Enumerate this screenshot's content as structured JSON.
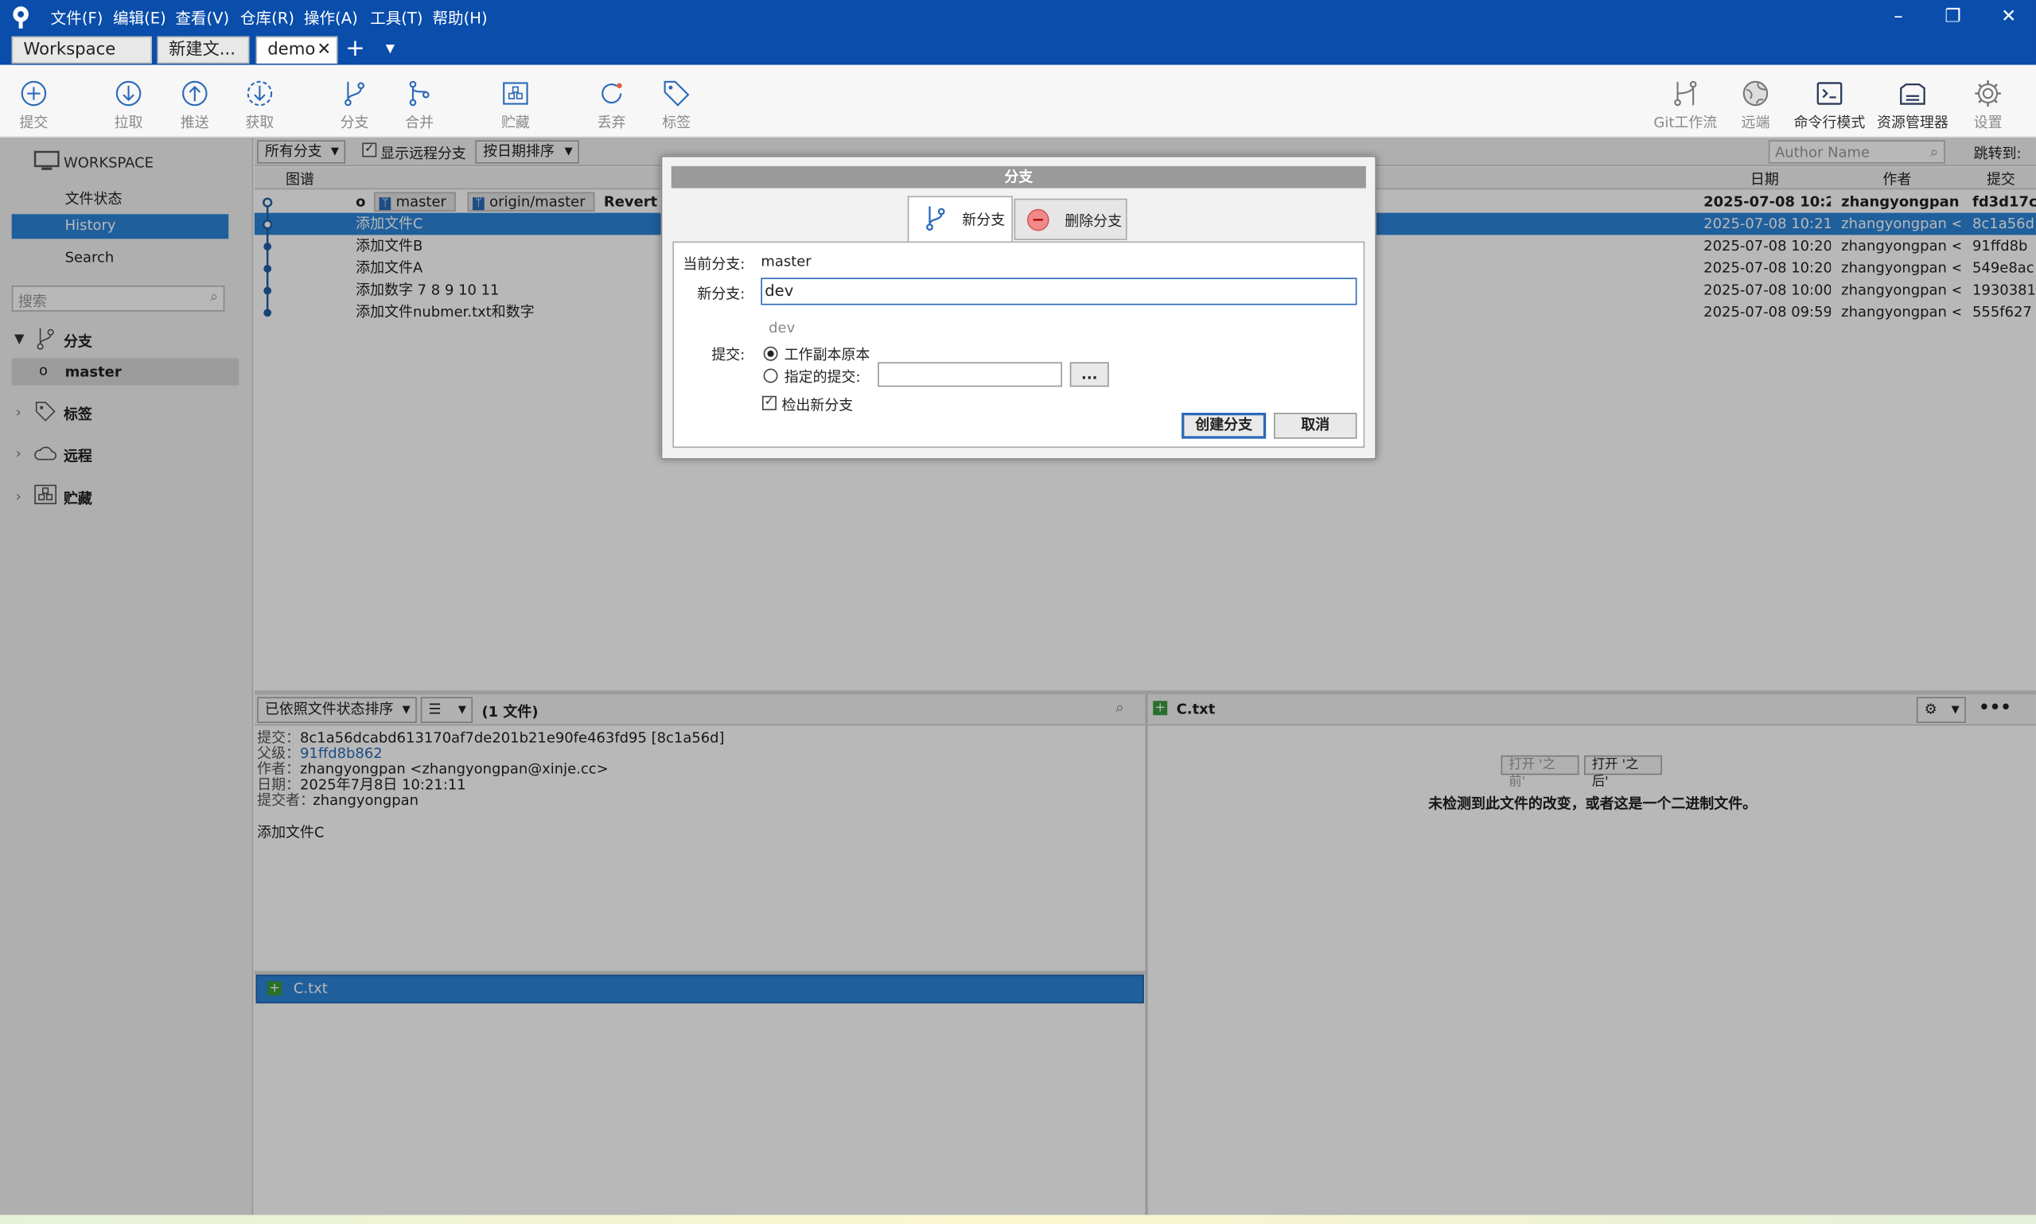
{
  "menu": [
    "文件(F)",
    "编辑(E)",
    "查看(V)",
    "仓库(R)",
    "操作(A)",
    "工具(T)",
    "帮助(H)"
  ],
  "tabs": [
    "Workspace",
    "新建文...",
    "demo"
  ],
  "toolbar_left": [
    {
      "label": "提交",
      "icon": "plus-circle-icon"
    },
    {
      "label": "拉取",
      "icon": "pull-icon"
    },
    {
      "label": "推送",
      "icon": "push-icon"
    },
    {
      "label": "获取",
      "icon": "fetch-icon"
    },
    {
      "label": "分支",
      "icon": "branch-icon"
    },
    {
      "label": "合并",
      "icon": "merge-icon"
    },
    {
      "label": "贮藏",
      "icon": "stash-icon"
    },
    {
      "label": "丢弃",
      "icon": "discard-icon"
    },
    {
      "label": "标签",
      "icon": "tag-icon"
    }
  ],
  "toolbar_right": [
    {
      "label": "Git工作流",
      "icon": "gitflow-icon"
    },
    {
      "label": "远端",
      "icon": "remote-globe-icon"
    },
    {
      "label": "命令行模式",
      "icon": "terminal-icon"
    },
    {
      "label": "资源管理器",
      "icon": "explorer-icon"
    },
    {
      "label": "设置",
      "icon": "gear-icon"
    }
  ],
  "sidebar": {
    "workspace": "WORKSPACE",
    "items": [
      "文件状态",
      "History",
      "Search"
    ],
    "search_placeholder": "搜索",
    "branches_header": "分支",
    "branch": "master",
    "tags": "标签",
    "remotes": "远程",
    "stashes": "贮藏"
  },
  "filters": {
    "branches": "所有分支",
    "show_remote": "显示远程分支",
    "sort": "按日期排序",
    "author_placeholder": "Author Name",
    "jump": "跳转到:"
  },
  "columns": {
    "graph": "图谱",
    "date": "日期",
    "author": "作者",
    "commit": "提交"
  },
  "commits": [
    {
      "labels": [
        "master",
        "origin/master"
      ],
      "message": "Revert \"",
      "date": "2025-07-08 10:2!",
      "author": "zhangyongpan ‹",
      "hash": "fd3d17c"
    },
    {
      "message": "添加文件C",
      "date": "2025-07-08 10:21",
      "author": "zhangyongpan <",
      "hash": "8c1a56d"
    },
    {
      "message": "添加文件B",
      "date": "2025-07-08 10:20",
      "author": "zhangyongpan <",
      "hash": "91ffd8b"
    },
    {
      "message": "添加文件A",
      "date": "2025-07-08 10:20",
      "author": "zhangyongpan <",
      "hash": "549e8ac"
    },
    {
      "message": "添加数字 7 8 9 10 11",
      "date": "2025-07-08 10:00",
      "author": "zhangyongpan <",
      "hash": "1930381"
    },
    {
      "message": "添加文件nubmer.txt和数字",
      "date": "2025-07-08 09:59",
      "author": "zhangyongpan <",
      "hash": "555f627"
    }
  ],
  "details": {
    "sort_label": "已依照文件状态排序",
    "file_count": "(1 文件)",
    "commit_label": "提交：",
    "commit_value": "8c1a56dcabd613170af7de201b21e90fe463fd95 [8c1a56d]",
    "parent_label": "父级：",
    "parent_value": "91ffd8b862",
    "author_label": "作者：",
    "author_value": "zhangyongpan <zhangyongpan@xinje.cc>",
    "date_label": "日期：",
    "date_value": "2025年7月8日 10:21:11",
    "committer_label": "提交者：",
    "committer_value": "zhangyongpan",
    "message": "添加文件C",
    "file": "C.txt"
  },
  "diff": {
    "file": "C.txt",
    "open_before": "打开 '之前'",
    "open_after": "打开 '之后'",
    "notice": "未检测到此文件的改变，或者这是一个二进制文件。"
  },
  "dialog": {
    "title": "分支",
    "tab_new": "新分支",
    "tab_delete": "删除分支",
    "current_label": "当前分支:",
    "current_value": "master",
    "new_label": "新分支:",
    "new_value": "dev",
    "preview": "dev",
    "commit_label": "提交:",
    "opt_working": "工作副本原本",
    "opt_specified": "指定的提交:",
    "ellipsis": "...",
    "checkout": "检出新分支",
    "create": "创建分支",
    "cancel": "取消"
  },
  "colors": {
    "titlebar": "#0a4dab",
    "selection": "#2c84d8",
    "graph": "#1f5fa8"
  }
}
